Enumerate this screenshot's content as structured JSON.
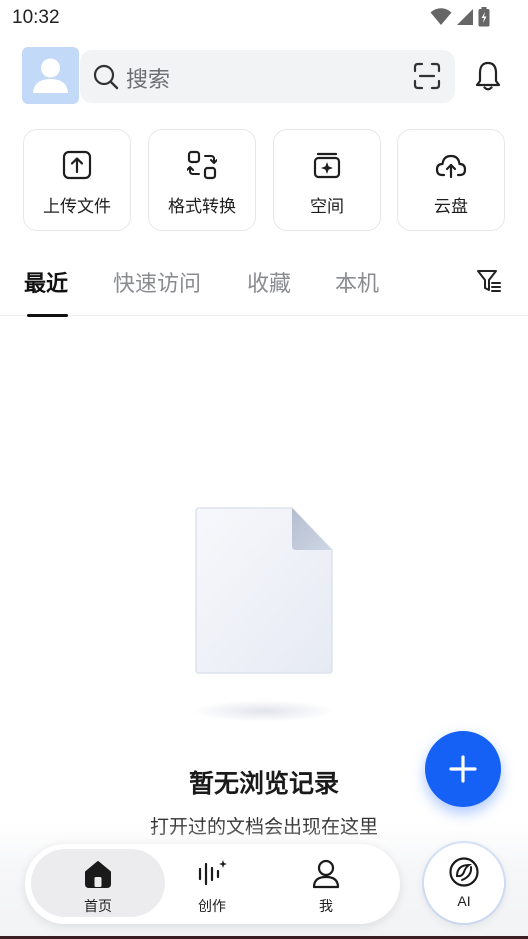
{
  "status_bar": {
    "time": "10:32"
  },
  "header": {
    "search_placeholder": "搜索"
  },
  "quick_actions": [
    {
      "label": "上传文件",
      "icon": "upload-icon"
    },
    {
      "label": "格式转换",
      "icon": "convert-icon"
    },
    {
      "label": "空间",
      "icon": "space-icon"
    },
    {
      "label": "云盘",
      "icon": "cloud-upload-icon"
    }
  ],
  "tabs": [
    {
      "label": "最近",
      "active": true
    },
    {
      "label": "快速访问",
      "active": false
    },
    {
      "label": "收藏",
      "active": false
    },
    {
      "label": "本机",
      "active": false
    }
  ],
  "empty_state": {
    "title": "暂无浏览记录",
    "subtitle": "打开过的文档会出现在这里"
  },
  "bottom_nav": {
    "items": [
      {
        "label": "首页",
        "active": true
      },
      {
        "label": "创作",
        "active": false
      },
      {
        "label": "我",
        "active": false
      }
    ],
    "ai_label": "AI"
  },
  "colors": {
    "accent": "#1560f5",
    "avatar_bg": "#c3d9f8",
    "search_bg": "#f2f3f5"
  }
}
